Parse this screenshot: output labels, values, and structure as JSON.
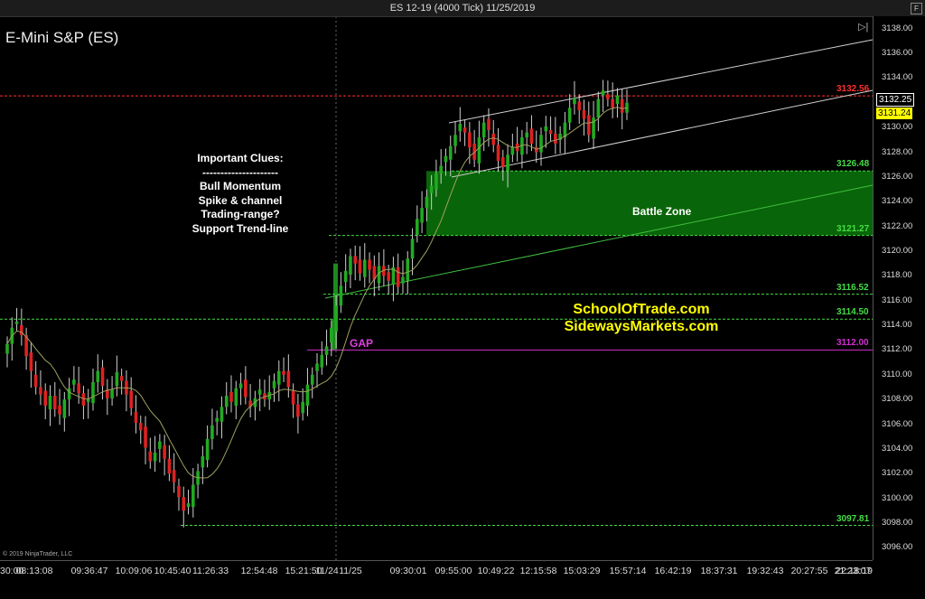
{
  "header": {
    "title": "ES 12-19 (4000 Tick)  11/25/2019",
    "instrument": "E-Mini S&P (ES)",
    "f_button": "F"
  },
  "copyright": "© 2019 NinjaTrader, LLC",
  "annotations": {
    "clues": [
      "Important Clues:",
      "---------------------",
      "Bull Momentum",
      "Spike & channel",
      "Trading-range?",
      "Support Trend-line"
    ],
    "battle_zone": "Battle Zone",
    "gap": "GAP",
    "sites": [
      "SchoolOfTrade.com",
      "SidewaysMarkets.com"
    ]
  },
  "colors": {
    "up": "#22aa22",
    "down": "#dd2222",
    "zone": "#0a6a0a",
    "ma": "#a0a060",
    "red_level": "#ff3030",
    "green_level": "#44dd44",
    "magenta_level": "#d030d0",
    "current_price_bg": "#ffff00"
  },
  "chart_data": {
    "type": "candlestick",
    "title": "ES 12-19 (4000 Tick)  11/25/2019",
    "instrument": "E-Mini S&P (ES)",
    "ylim": [
      3095,
      3139
    ],
    "y_ticks": [
      3096,
      3098,
      3100,
      3102,
      3104,
      3106,
      3108,
      3110,
      3112,
      3114,
      3116,
      3118,
      3120,
      3122,
      3124,
      3126,
      3128,
      3130,
      3132,
      3134,
      3136,
      3138
    ],
    "y_tick_labels": [
      "3096.00",
      "3098.00",
      "3100.00",
      "3102.00",
      "3104.00",
      "3106.00",
      "3108.00",
      "3110.00",
      "3112.00",
      "3114.00",
      "3116.00",
      "3118.00",
      "3120.00",
      "3122.00",
      "3124.00",
      "3126.00",
      "3128.00",
      "3130.00",
      "3132.00",
      "3134.00",
      "3136.00",
      "3138.00"
    ],
    "x_tick_labels": [
      "30:00",
      "08:13:08",
      "09:36:47",
      "10:09:06",
      "10:45:40",
      "11:26:33",
      "12:54:48",
      "15:21:50",
      "11/24",
      "11/25",
      "09:30:01",
      "09:55:00",
      "10:49:22",
      "12:15:58",
      "15:03:29",
      "15:57:14",
      "16:42:19",
      "18:37:31",
      "19:32:43",
      "20:27:55",
      "21:23:07",
      "22:18:19"
    ],
    "price_levels": [
      {
        "value": 3132.56,
        "label": "3132.56",
        "color": "red"
      },
      {
        "value": 3126.48,
        "label": "3126.48",
        "color": "green"
      },
      {
        "value": 3121.27,
        "label": "3121.27",
        "color": "green"
      },
      {
        "value": 3116.52,
        "label": "3116.52",
        "color": "green"
      },
      {
        "value": 3114.5,
        "label": "3114.50",
        "color": "green"
      },
      {
        "value": 3112.0,
        "label": "3112.00",
        "color": "magenta"
      },
      {
        "value": 3097.81,
        "label": "3097.81",
        "color": "green"
      }
    ],
    "last_price": "3132.25",
    "current_price": "3131.24",
    "zone": {
      "low": 3121.27,
      "high": 3126.48
    },
    "gap": {
      "low": 3112.0,
      "high": 3114.5
    },
    "closes": [
      3112.5,
      3113.8,
      3114.3,
      3113.2,
      3111.5,
      3110.3,
      3109.0,
      3108.4,
      3107.5,
      3108.3,
      3107.2,
      3106.8,
      3108.0,
      3108.9,
      3109.6,
      3108.5,
      3107.5,
      3108.0,
      3109.4,
      3110.3,
      3109.1,
      3108.1,
      3108.8,
      3110.2,
      3109.5,
      3108.4,
      3107.3,
      3106.1,
      3105.5,
      3104.1,
      3103.0,
      3103.7,
      3104.6,
      3103.2,
      3102.0,
      3101.3,
      3100.1,
      3099.0,
      3099.6,
      3101.1,
      3102.2,
      3103.4,
      3104.8,
      3105.9,
      3106.5,
      3107.4,
      3108.3,
      3107.8,
      3108.9,
      3109.3,
      3108.2,
      3107.4,
      3108.1,
      3108.8,
      3108.0,
      3108.6,
      3109.5,
      3110.3,
      3110.0,
      3109.0,
      3107.6,
      3106.6,
      3107.8,
      3109.2,
      3110.0,
      3110.9,
      3111.6,
      3112.3,
      3113.8,
      3115.6,
      3117.2,
      3118.4,
      3119.6,
      3119.0,
      3118.2,
      3119.3,
      3118.5,
      3117.7,
      3118.8,
      3118.0,
      3117.6,
      3118.7,
      3117.1,
      3117.9,
      3119.4,
      3121.0,
      3122.6,
      3123.5,
      3124.4,
      3125.3,
      3126.3,
      3126.9,
      3127.7,
      3128.5,
      3129.4,
      3130.3,
      3129.6,
      3128.4,
      3127.4,
      3129.2,
      3130.4,
      3129.8,
      3128.6,
      3127.3,
      3126.8,
      3127.8,
      3128.4,
      3128.1,
      3129.2,
      3129.6,
      3128.7,
      3128.0,
      3129.4,
      3130.1,
      3129.5,
      3128.7,
      3129.5,
      3130.4,
      3131.6,
      3132.4,
      3131.4,
      3130.7,
      3129.4,
      3130.8,
      3132.3,
      3133.0,
      3132.3,
      3131.6,
      3132.6,
      3131.2,
      3132.0
    ]
  }
}
